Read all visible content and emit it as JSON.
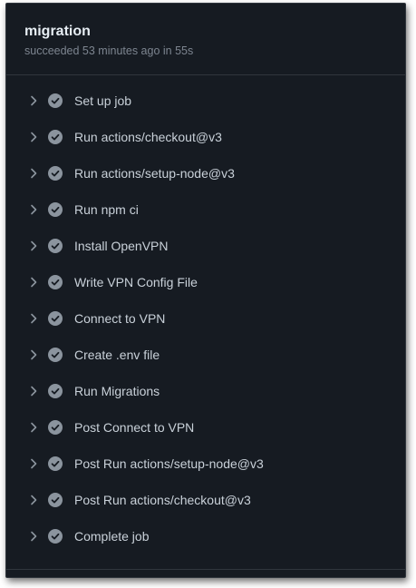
{
  "job": {
    "title": "migration",
    "status": "succeeded 53 minutes ago in 55s"
  },
  "colors": {
    "panel_background": "#161b22",
    "border": "#30363d",
    "title_text": "#e6edf3",
    "muted_text": "#7d8590",
    "step_text": "#c9d1d9",
    "success_icon": "#8b949e"
  },
  "steps": [
    {
      "label": "Set up job",
      "status": "success",
      "icon": "check-circle-fill-icon",
      "expand_icon": "chevron-right-icon"
    },
    {
      "label": "Run actions/checkout@v3",
      "status": "success",
      "icon": "check-circle-fill-icon",
      "expand_icon": "chevron-right-icon"
    },
    {
      "label": "Run actions/setup-node@v3",
      "status": "success",
      "icon": "check-circle-fill-icon",
      "expand_icon": "chevron-right-icon"
    },
    {
      "label": "Run npm ci",
      "status": "success",
      "icon": "check-circle-fill-icon",
      "expand_icon": "chevron-right-icon"
    },
    {
      "label": "Install OpenVPN",
      "status": "success",
      "icon": "check-circle-fill-icon",
      "expand_icon": "chevron-right-icon"
    },
    {
      "label": "Write VPN Config File",
      "status": "success",
      "icon": "check-circle-fill-icon",
      "expand_icon": "chevron-right-icon"
    },
    {
      "label": "Connect to VPN",
      "status": "success",
      "icon": "check-circle-fill-icon",
      "expand_icon": "chevron-right-icon"
    },
    {
      "label": "Create .env file",
      "status": "success",
      "icon": "check-circle-fill-icon",
      "expand_icon": "chevron-right-icon"
    },
    {
      "label": "Run Migrations",
      "status": "success",
      "icon": "check-circle-fill-icon",
      "expand_icon": "chevron-right-icon"
    },
    {
      "label": "Post Connect to VPN",
      "status": "success",
      "icon": "check-circle-fill-icon",
      "expand_icon": "chevron-right-icon"
    },
    {
      "label": "Post Run actions/setup-node@v3",
      "status": "success",
      "icon": "check-circle-fill-icon",
      "expand_icon": "chevron-right-icon"
    },
    {
      "label": "Post Run actions/checkout@v3",
      "status": "success",
      "icon": "check-circle-fill-icon",
      "expand_icon": "chevron-right-icon"
    },
    {
      "label": "Complete job",
      "status": "success",
      "icon": "check-circle-fill-icon",
      "expand_icon": "chevron-right-icon"
    }
  ]
}
